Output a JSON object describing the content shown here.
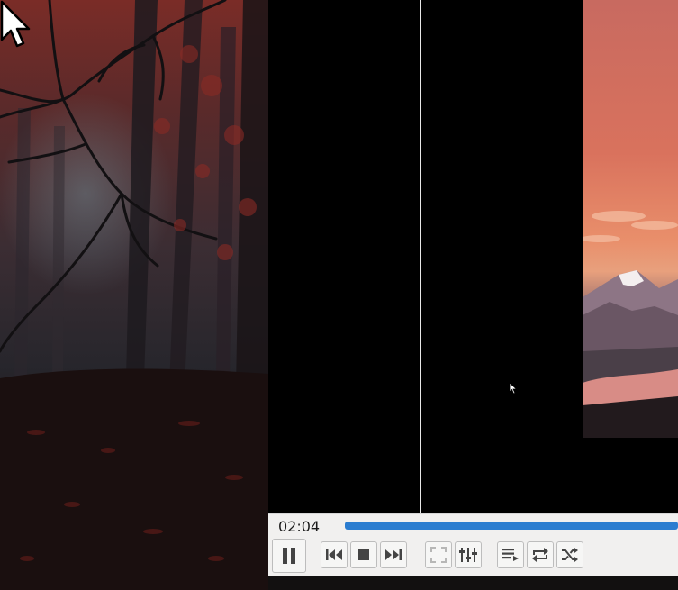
{
  "player": {
    "elapsed_time": "02:04",
    "progress_fraction": 1.0,
    "colors": {
      "accent": "#2b7dd0",
      "toolbar_bg": "#f1f0ef"
    }
  },
  "controls": {
    "buttons": [
      {
        "name": "pause-button",
        "icon": "pause-icon"
      },
      {
        "name": "previous-button",
        "icon": "skip-back-icon"
      },
      {
        "name": "stop-button",
        "icon": "stop-icon"
      },
      {
        "name": "next-button",
        "icon": "skip-forward-icon"
      },
      {
        "name": "fullscreen-button",
        "icon": "fullscreen-icon"
      },
      {
        "name": "extended-settings-button",
        "icon": "equalizer-icon"
      },
      {
        "name": "playlist-button",
        "icon": "playlist-icon"
      },
      {
        "name": "loop-button",
        "icon": "repeat-icon"
      },
      {
        "name": "shuffle-button",
        "icon": "shuffle-icon"
      }
    ]
  }
}
